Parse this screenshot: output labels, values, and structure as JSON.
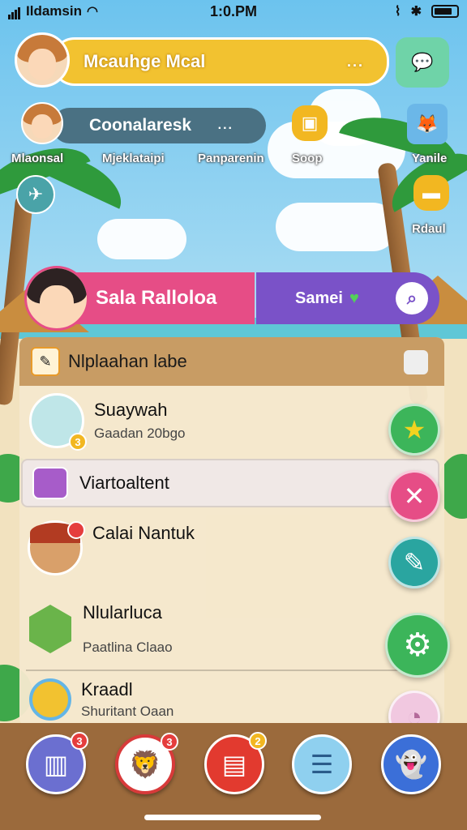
{
  "status_bar": {
    "carrier": "Ildamsin",
    "time": "1:0.PM"
  },
  "profile_bar": {
    "title": "Mcauhge Mcal",
    "menu": "..."
  },
  "second_bar": {
    "title": "Coonalaresk",
    "menu": "..."
  },
  "top_labels": [
    "Mlaonsal",
    "Mjeklataipi",
    "Panparenin",
    "Soop",
    "Yanile",
    "Rdaul"
  ],
  "profile_card": {
    "name": "Sala Ralloloa",
    "action": "Samei"
  },
  "panel": {
    "header": "Nlplaahan labe",
    "items": [
      {
        "title": "Suaywah",
        "sub": "Gaadan 20bgo",
        "badge": "3"
      },
      {
        "title": "Viartoaltent"
      },
      {
        "title": "Calai Nantuk"
      },
      {
        "title": "Nlularluca",
        "sub": "Paatlina Claao"
      },
      {
        "title": "Kraadl",
        "sub": "Shuritant Oaan"
      }
    ]
  },
  "bottom_nav": [
    {
      "icon": "map-icon",
      "badge": "3"
    },
    {
      "icon": "lion-icon",
      "badge": "3"
    },
    {
      "icon": "shop-icon",
      "badge": "2"
    },
    {
      "icon": "chat-icon"
    },
    {
      "icon": "ghost-icon"
    }
  ],
  "colors": {
    "yellow": "#f2c230",
    "pink": "#e64d86",
    "purple": "#7a52c8",
    "green": "#3cb55a",
    "red": "#e23a4f"
  }
}
